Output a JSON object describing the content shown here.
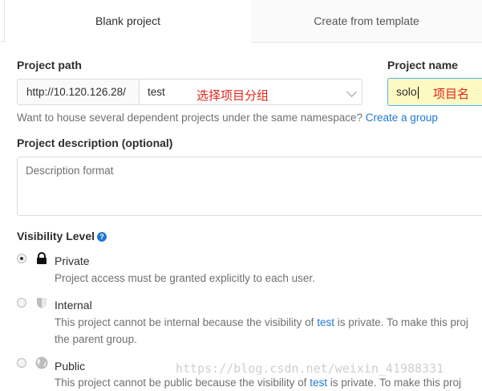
{
  "tabs": {
    "blank": "Blank project",
    "template": "Create from template"
  },
  "project_path": {
    "label": "Project path",
    "prefix": "http://10.120.126.28/",
    "namespace": "test",
    "annotation": "选择项目分组"
  },
  "project_name": {
    "label": "Project name",
    "value": "solo",
    "annotation": "项目名"
  },
  "namespace_help": {
    "text": "Want to house several dependent projects under the same namespace? ",
    "link": "Create a group"
  },
  "description": {
    "label": "Project description (optional)",
    "placeholder": "Description format"
  },
  "visibility": {
    "label": "Visibility Level",
    "help_icon": "question-circle-icon",
    "options": [
      {
        "title": "Private",
        "icon": "lock-icon",
        "desc": "Project access must be granted explicitly to each user.",
        "checked": true
      },
      {
        "title": "Internal",
        "icon": "shield-icon",
        "desc_prefix": "This project cannot be internal because the visibility of ",
        "desc_link": "test",
        "desc_suffix": " is private. To make this proj",
        "desc_line2": "the parent group."
      },
      {
        "title": "Public",
        "icon": "globe-icon",
        "desc_prefix": "This project cannot be public because the visibility of ",
        "desc_link": "test",
        "desc_suffix": " is private. To make this proj"
      }
    ]
  },
  "watermark": "https://blog.csdn.net/weixin_41988331"
}
